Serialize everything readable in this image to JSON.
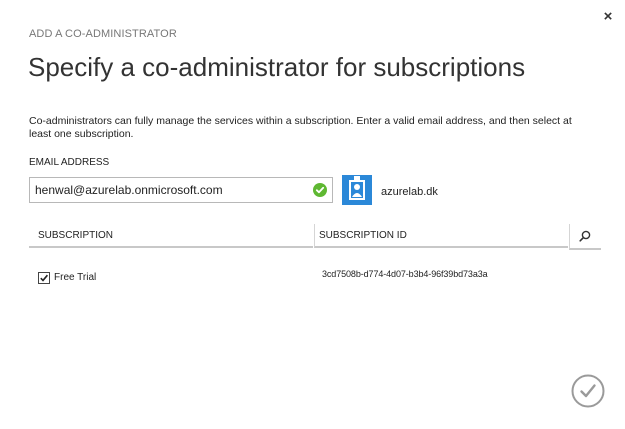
{
  "dialog": {
    "close_glyph": "×",
    "step_label": "ADD A CO-ADMINISTRATOR",
    "title": "Specify a co-administrator for subscriptions",
    "description": "Co-administrators can fully manage the services within a subscription. Enter a valid email address, and then select at least one subscription."
  },
  "email": {
    "label": "EMAIL ADDRESS",
    "value": "henwal@azurelab.onmicrosoft.com",
    "valid_icon": "check-circle-icon",
    "valid_color": "#5fb832"
  },
  "directory": {
    "icon": "user-badge-icon",
    "name": "azurelab.dk",
    "icon_color": "#2b88d8"
  },
  "table": {
    "columns": [
      "SUBSCRIPTION",
      "SUBSCRIPTION ID"
    ],
    "search_icon": "search-icon",
    "rows": [
      {
        "checked": true,
        "name": "Free Trial",
        "id": "3cd7508b-d774-4d07-b3b4-96f39bd73a3a"
      }
    ]
  },
  "footer": {
    "confirm_icon": "checkmark-circle-icon"
  }
}
